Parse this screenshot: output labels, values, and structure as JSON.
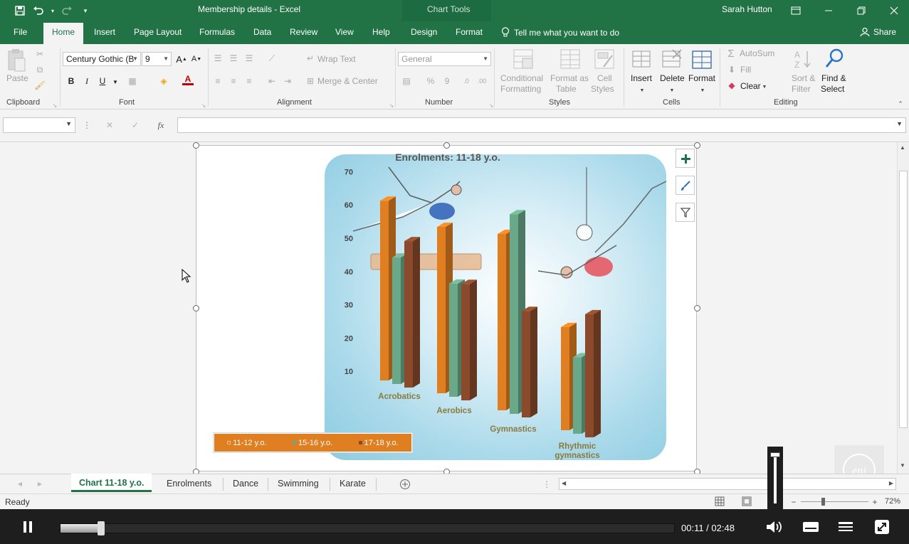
{
  "titlebar": {
    "doc_title": "Membership details - Excel",
    "context_label": "Chart Tools",
    "user": "Sarah Hutton"
  },
  "ribbon_tabs": {
    "file": "File",
    "home": "Home",
    "insert": "Insert",
    "page_layout": "Page Layout",
    "formulas": "Formulas",
    "data": "Data",
    "review": "Review",
    "view": "View",
    "help": "Help",
    "design": "Design",
    "format": "Format",
    "tell_me": "Tell me what you want to do",
    "share": "Share"
  },
  "ribbon": {
    "clipboard": {
      "label": "Clipboard",
      "paste": "Paste"
    },
    "font": {
      "label": "Font",
      "font_name": "Century Gothic (B",
      "font_size": "9",
      "bold": "B",
      "italic": "I",
      "underline": "U"
    },
    "alignment": {
      "label": "Alignment",
      "wrap_text": "Wrap Text",
      "merge_center": "Merge & Center"
    },
    "number": {
      "label": "Number",
      "format": "General",
      "percent": "%",
      "comma": "9"
    },
    "styles": {
      "label": "Styles",
      "conditional": "Conditional\nFormatting",
      "conditional_1": "Conditional",
      "conditional_2": "Formatting",
      "format_table_1": "Format as",
      "format_table_2": "Table",
      "cell_styles_1": "Cell",
      "cell_styles_2": "Styles"
    },
    "cells": {
      "label": "Cells",
      "insert": "Insert",
      "delete": "Delete",
      "format": "Format"
    },
    "editing": {
      "label": "Editing",
      "autosum": "AutoSum",
      "fill": "Fill",
      "clear": "Clear",
      "sort_1": "Sort &",
      "sort_2": "Filter",
      "find_1": "Find &",
      "find_2": "Select"
    }
  },
  "formula_bar": {
    "name_box": "",
    "fx": "fx",
    "value": ""
  },
  "chart_data": {
    "type": "bar",
    "title": "Enrolments: 11-18 y.o.",
    "categories": [
      "Acrobatics",
      "Aerobics",
      "Gymnastics",
      "Rhythmic gymnastics"
    ],
    "series": [
      {
        "name": "11-12 y.o.",
        "values": [
          54,
          50,
          53,
          31
        ]
      },
      {
        "name": "15-16 y.o.",
        "values": [
          38,
          34,
          60,
          23
        ]
      },
      {
        "name": "17-18 y.o.",
        "values": [
          44,
          35,
          32,
          37
        ]
      }
    ],
    "ylim": [
      0,
      70
    ],
    "yticks": [
      "10",
      "20",
      "30",
      "40",
      "50",
      "60",
      "70"
    ],
    "legend_position": "bottom-left",
    "colors": {
      "11-12 y.o.": "#e07f22",
      "15-16 y.o.": "#6aa88a",
      "17-18 y.o.": "#8b4a2b"
    }
  },
  "legend": {
    "s1": "11-12 y.o.",
    "s2": "15-16 y.o.",
    "s3": "17-18 y.o."
  },
  "sheet_tabs": [
    "Chart 11-18 y.o.",
    "Enrolments",
    "Dance",
    "Swimming",
    "Karate"
  ],
  "status": {
    "text": "Ready",
    "zoom": "72%"
  },
  "player": {
    "time": "00:11 / 02:48",
    "progress": 0.065
  }
}
